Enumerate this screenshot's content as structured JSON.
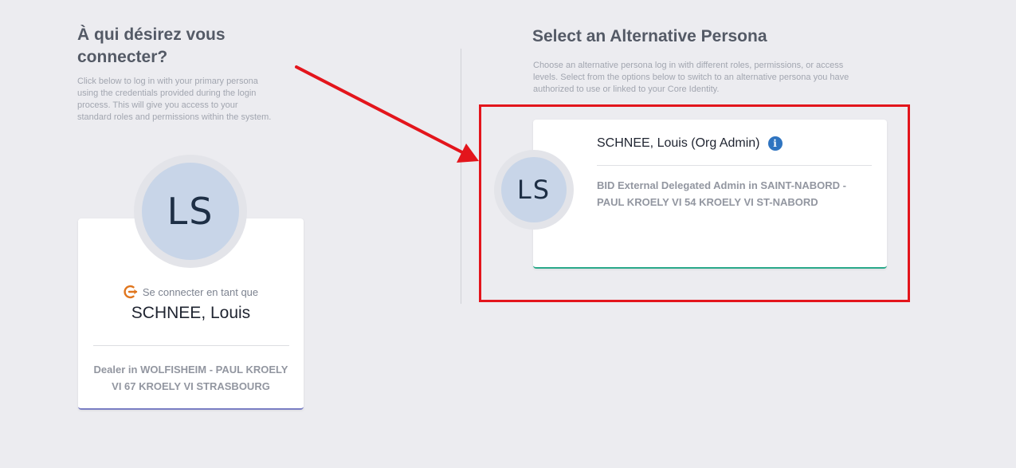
{
  "primary": {
    "title": "À qui désirez vous connecter?",
    "description": "Click below to log in with your primary persona using the credentials provided during the login process. This will give you access to your standard roles and permissions within the system.",
    "avatar_initials": "LS",
    "connect_label": "Se connecter en tant que",
    "name": "SCHNEE, Louis",
    "role": "Dealer in WOLFISHEIM - PAUL KROELY VI 67 KROELY VI STRASBOURG",
    "accent_color": "#7a7ec4"
  },
  "alternative": {
    "title": "Select an Alternative Persona",
    "description": "Choose an alternative persona log in with different roles, permissions, or access levels. Select from the options below to switch to an alternative persona you have authorized to use or linked to your Core Identity.",
    "personas": [
      {
        "avatar_initials": "LS",
        "name": "SCHNEE, Louis (Org Admin)",
        "info_icon": "i",
        "role": "BID External Delegated Admin in SAINT-NABORD - PAUL KROELY VI 54 KROELY VI ST-NABORD",
        "accent_color": "#2aa98a"
      }
    ]
  },
  "annotation": {
    "highlight_color": "#e3151c",
    "arrow_color": "#e3151c"
  }
}
